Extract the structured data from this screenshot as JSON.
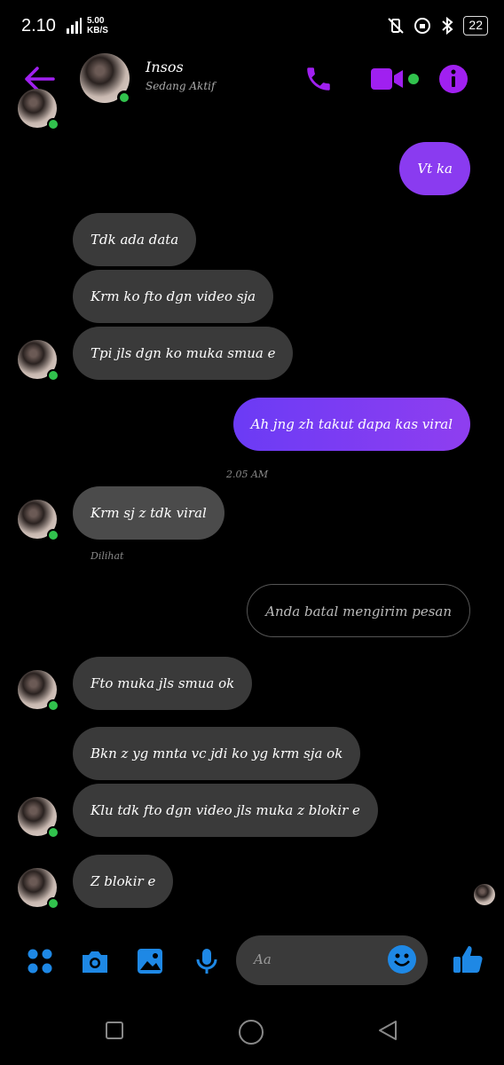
{
  "status_bar": {
    "time": "2.10",
    "network": "4G",
    "speed_value": "5.00",
    "speed_unit": "KB/S",
    "battery": "22"
  },
  "header": {
    "contact_name": "Insos",
    "contact_status": "Sedang Aktif"
  },
  "messages": [
    {
      "side": "out",
      "text": "Vt ka"
    },
    {
      "side": "in",
      "text": "Tdk ada data"
    },
    {
      "side": "in",
      "text": "Krm ko fto dgn video sja"
    },
    {
      "side": "in",
      "text": "Tpi jls dgn ko muka smua e"
    },
    {
      "side": "out",
      "text": "Ah jng zh takut dapa kas viral"
    },
    {
      "side": "in",
      "text": "Krm sj z tdk viral"
    },
    {
      "side": "unsent",
      "text": "Anda batal mengirim pesan"
    },
    {
      "side": "in",
      "text": "Fto muka jls smua ok"
    },
    {
      "side": "in",
      "text": "Bkn z yg mnta vc jdi ko yg krm sja ok"
    },
    {
      "side": "in",
      "text": "Klu tdk fto dgn video jls muka z blokir e"
    },
    {
      "side": "in",
      "text": "Z blokir e"
    }
  ],
  "timestamp": "2.05 AM",
  "seen_label": "Dilihat",
  "composer": {
    "placeholder": "Aa"
  },
  "colors": {
    "accent_purple": "#a020f0",
    "messenger_blue": "#1e88e5",
    "online_green": "#31c24d"
  }
}
